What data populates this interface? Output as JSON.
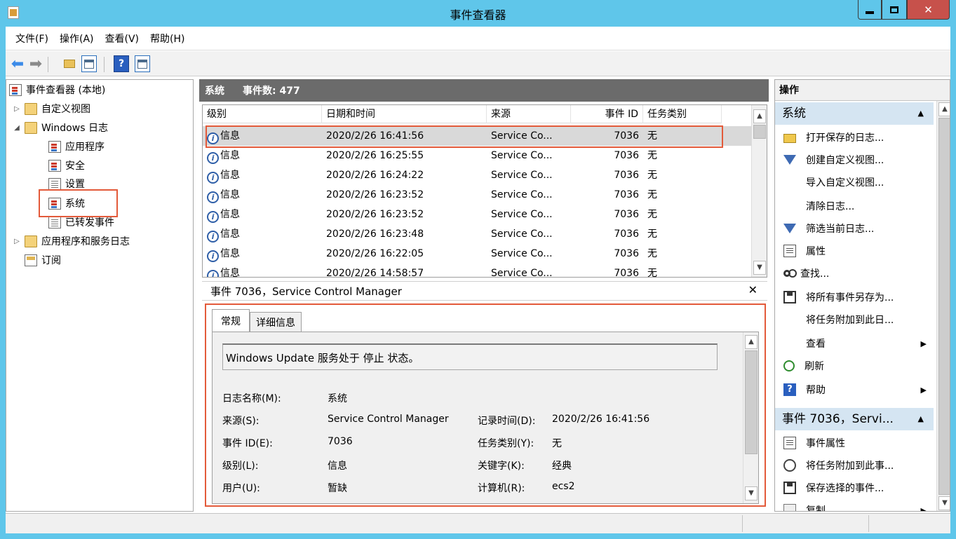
{
  "window": {
    "title": "事件查看器"
  },
  "menu": [
    "文件(F)",
    "操作(A)",
    "查看(V)",
    "帮助(H)"
  ],
  "tree": {
    "root": "事件查看器 (本地)",
    "custom_views": "自定义视图",
    "windows_logs": "Windows 日志",
    "logs": [
      "应用程序",
      "安全",
      "设置",
      "系统",
      "已转发事件"
    ],
    "app_service_logs": "应用程序和服务日志",
    "subscriptions": "订阅"
  },
  "center": {
    "log_name": "系统",
    "event_count": "事件数: 477",
    "columns": [
      "级别",
      "日期和时间",
      "来源",
      "事件 ID",
      "任务类别"
    ],
    "rows": [
      {
        "level": "信息",
        "datetime": "2020/2/26 16:41:56",
        "source": "Service Co...",
        "event_id": "7036",
        "task": "无"
      },
      {
        "level": "信息",
        "datetime": "2020/2/26 16:25:55",
        "source": "Service Co...",
        "event_id": "7036",
        "task": "无"
      },
      {
        "level": "信息",
        "datetime": "2020/2/26 16:24:22",
        "source": "Service Co...",
        "event_id": "7036",
        "task": "无"
      },
      {
        "level": "信息",
        "datetime": "2020/2/26 16:23:52",
        "source": "Service Co...",
        "event_id": "7036",
        "task": "无"
      },
      {
        "level": "信息",
        "datetime": "2020/2/26 16:23:52",
        "source": "Service Co...",
        "event_id": "7036",
        "task": "无"
      },
      {
        "level": "信息",
        "datetime": "2020/2/26 16:23:48",
        "source": "Service Co...",
        "event_id": "7036",
        "task": "无"
      },
      {
        "level": "信息",
        "datetime": "2020/2/26 16:22:05",
        "source": "Service Co...",
        "event_id": "7036",
        "task": "无"
      },
      {
        "level": "信息",
        "datetime": "2020/2/26 14:58:57",
        "source": "Service Co...",
        "event_id": "7036",
        "task": "无"
      }
    ],
    "detail": {
      "title": "事件 7036，Service Control Manager",
      "tabs": [
        "常规",
        "详细信息"
      ],
      "description": "Windows Update 服务处于 停止 状态。",
      "log_name_label": "日志名称(M):",
      "log_name_value": "系统",
      "source_label": "来源(S):",
      "source_value": "Service Control Manager",
      "logged_label": "记录时间(D):",
      "logged_value": "2020/2/26 16:41:56",
      "event_id_label": "事件 ID(E):",
      "event_id_value": "7036",
      "task_label": "任务类别(Y):",
      "task_value": "无",
      "level_label": "级别(L):",
      "level_value": "信息",
      "keywords_label": "关键字(K):",
      "keywords_value": "经典",
      "user_label": "用户(U):",
      "user_value": "暂缺",
      "computer_label": "计算机(R):",
      "computer_value": "ecs2"
    }
  },
  "actions": {
    "title": "操作",
    "section1": "系统",
    "items1": [
      {
        "label": "打开保存的日志...",
        "icon": "folder-open-icon"
      },
      {
        "label": "创建自定义视图...",
        "icon": "filter-icon"
      },
      {
        "label": "导入自定义视图...",
        "icon": ""
      },
      {
        "label": "清除日志...",
        "icon": ""
      },
      {
        "label": "筛选当前日志...",
        "icon": "filter-icon"
      },
      {
        "label": "属性",
        "icon": "properties-icon"
      },
      {
        "label": "查找...",
        "icon": "find-icon"
      },
      {
        "label": "将所有事件另存为...",
        "icon": "save-icon"
      },
      {
        "label": "将任务附加到此日...",
        "icon": ""
      },
      {
        "label": "查看",
        "icon": "",
        "submenu": true
      },
      {
        "label": "刷新",
        "icon": "refresh-icon"
      },
      {
        "label": "帮助",
        "icon": "help-icon",
        "submenu": true
      }
    ],
    "section2": "事件 7036，Servi...",
    "items2": [
      {
        "label": "事件属性",
        "icon": "properties-icon"
      },
      {
        "label": "将任务附加到此事...",
        "icon": "clock-icon"
      },
      {
        "label": "保存选择的事件...",
        "icon": "save-icon"
      },
      {
        "label": "复制",
        "icon": "copy-icon",
        "submenu": true
      }
    ]
  }
}
